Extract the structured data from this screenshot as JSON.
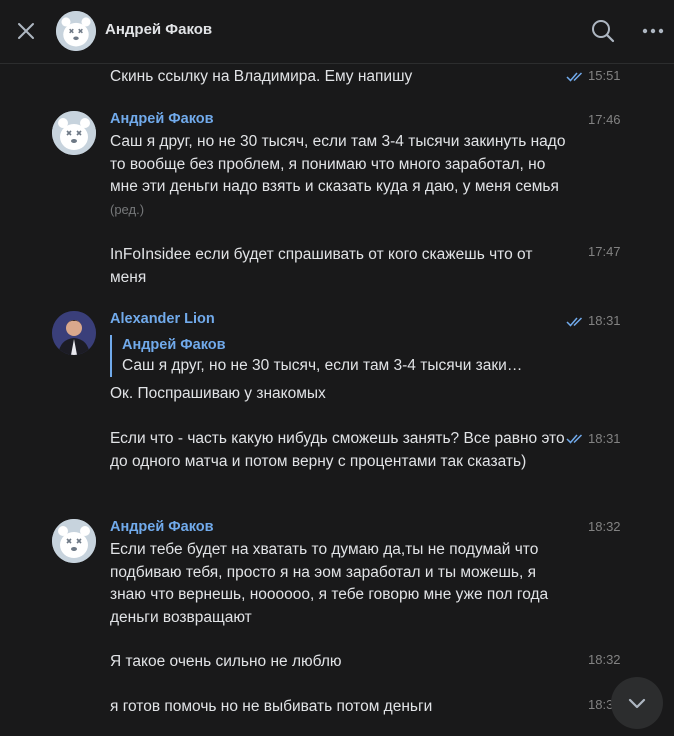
{
  "header": {
    "title": "Андрей Факов"
  },
  "messages": [
    {
      "text": "Скинь ссылку на Владимира. Ему напишу",
      "time": "15:51"
    },
    {
      "author": "Андрей Факов",
      "text": "Саш я друг, но не 30 тысяч, если там 3-4 тысячи закинуть надо то вообще без проблем, я понимаю что много заработал, но мне эти деньги надо взять и сказать куда я даю, у меня семья",
      "edited": "(ред.)",
      "time": "17:46"
    },
    {
      "text": "InFoInsidee если будет спрашивать от кого скажешь что от меня",
      "time": "17:47"
    },
    {
      "author": "Alexander Lion",
      "reply_author": "Андрей Факов",
      "reply_text": "Саш я друг, но не 30 тысяч, если там 3-4 тысячи заки…",
      "text": "Ок. Поспрашиваю у знакомых",
      "time": "18:31"
    },
    {
      "text": "Если что - часть какую нибудь сможешь занять? Все равно это до одного матча и потом верну с процентами так сказать)",
      "time": "18:31"
    },
    {
      "author": "Андрей Факов",
      "text": "Если тебе будет на хватать то думаю да,ты не подумай что подбиваю тебя, просто я на эом заработал и ты можешь, я знаю что вернешь, ноооооо, я тебе говорю мне уже пол года деньги возвращают",
      "time": "18:32"
    },
    {
      "text": "Я такое очень сильно не люблю",
      "time": "18:32"
    },
    {
      "text": "я готов помочь но не выбивать потом деньги",
      "time": "18:3"
    }
  ],
  "colors": {
    "background": "#19191a",
    "accent": "#71aaeb",
    "text": "#e1e3e6",
    "muted": "#828282"
  }
}
